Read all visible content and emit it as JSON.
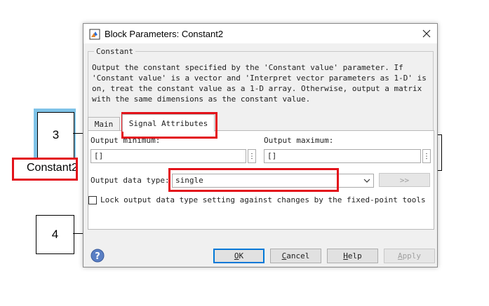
{
  "canvas": {
    "block_top_value": "3",
    "block_top_name": "Constant2",
    "block_bottom_value": "4"
  },
  "dialog": {
    "title": "Block Parameters: Constant2",
    "group_title": "Constant",
    "description": "Output the constant specified by the 'Constant value' parameter. If\n'Constant value' is a vector and 'Interpret vector parameters as 1-D' is\non, treat the constant value as a 1-D array. Otherwise, output a matrix\nwith the same dimensions as the constant value.",
    "tabs": [
      {
        "label": "Main"
      },
      {
        "label": "Signal Attributes"
      }
    ],
    "output_minimum_label": "Output minimum:",
    "output_minimum_value": "[]",
    "output_maximum_label": "Output maximum:",
    "output_maximum_value": "[]",
    "output_data_type_label": "Output data type:",
    "output_data_type_value": "single",
    "expand_button_label": ">>",
    "lock_checkbox_label": "Lock output data type setting against changes by the fixed-point tools",
    "lock_checked": false,
    "buttons": {
      "ok": {
        "u": "O",
        "rest": "K"
      },
      "cancel": {
        "u": "C",
        "rest": "ancel"
      },
      "help": {
        "u": "H",
        "rest": "elp"
      },
      "apply": {
        "u": "A",
        "rest": "pply"
      }
    },
    "dots_glyph": "⋮"
  },
  "colors": {
    "highlight": "#e3121a",
    "selection": "#7fc3e8",
    "default_button_border": "#0078d7"
  }
}
